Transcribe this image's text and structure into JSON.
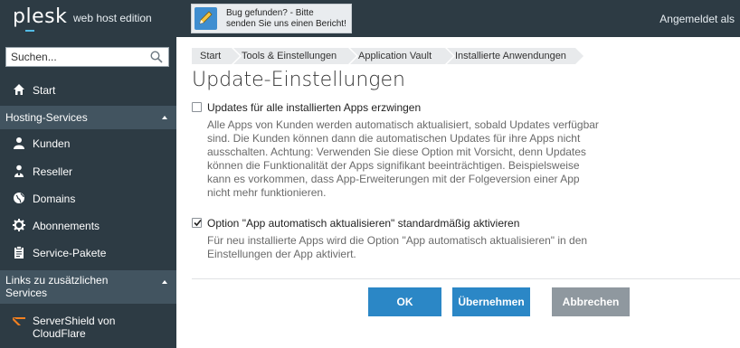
{
  "header": {
    "logo": "plesk",
    "edition": "web host edition",
    "bug_line1": "Bug gefunden? - Bitte",
    "bug_line2": "senden Sie uns einen Bericht!",
    "logged_in": "Angemeldet als"
  },
  "sidebar": {
    "search_placeholder": "Suchen...",
    "start": "Start",
    "section_hosting": "Hosting-Services",
    "items": {
      "customers": "Kunden",
      "reseller": "Reseller",
      "domains": "Domains",
      "subscriptions": "Abonnements",
      "plans": "Service-Pakete"
    },
    "section_links_line1": "Links zu zusätzlichen",
    "section_links_line2": "Services",
    "servershield_line1": "ServerShield von",
    "servershield_line2": "CloudFlare"
  },
  "breadcrumb": [
    "Start",
    "Tools & Einstellungen",
    "Application Vault",
    "Installierte Anwendungen"
  ],
  "page_title": "Update-Einstellungen",
  "options": [
    {
      "label": "Updates für alle installierten Apps erzwingen",
      "checked": false,
      "desc_lines": [
        "Alle Apps von Kunden werden automatisch aktualisiert, sobald Updates verfügbar",
        "sind. Die Kunden können dann die automatischen Updates für ihre Apps nicht",
        "ausschalten. Achtung: Verwenden Sie diese Option mit Vorsicht, denn Updates",
        "können die Funktionalität der Apps signifikant beeinträchtigen. Beispielsweise",
        "kann es vorkommen, dass App-Erweiterungen mit der Folgeversion einer App",
        "nicht mehr funktionieren."
      ]
    },
    {
      "label": "Option \"App automatisch aktualisieren\" standardmäßig aktivieren",
      "checked": true,
      "desc_lines": [
        "Für neu installierte Apps wird die Option \"App automatisch aktualisieren\" in den",
        "Einstellungen der App aktiviert."
      ]
    }
  ],
  "buttons": {
    "ok": "OK",
    "apply": "Übernehmen",
    "cancel": "Abbrechen"
  },
  "colors": {
    "sidebar": "#2d3b44",
    "section": "#425460",
    "primary": "#2b87c6",
    "disabled": "#8f989f"
  }
}
